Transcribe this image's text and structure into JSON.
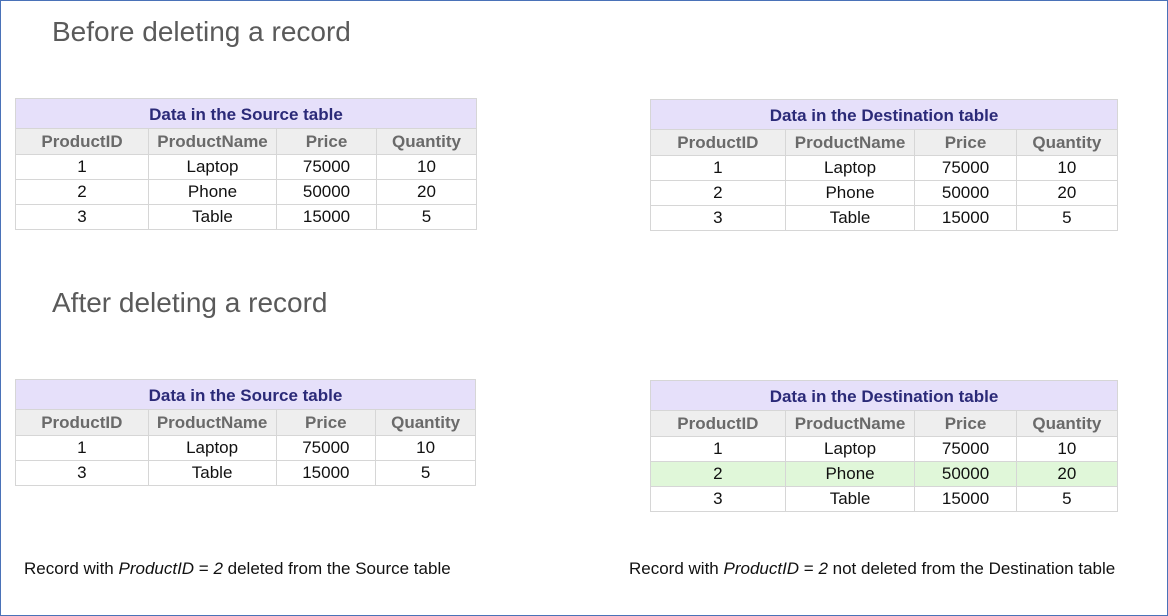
{
  "headings": {
    "before": "Before deleting a record",
    "after": "After deleting a record"
  },
  "columns": [
    "ProductID",
    "ProductName",
    "Price",
    "Quantity"
  ],
  "tables": {
    "source_before": {
      "title": "Data in the Source table",
      "rows": [
        [
          "1",
          "Laptop",
          "75000",
          "10"
        ],
        [
          "2",
          "Phone",
          "50000",
          "20"
        ],
        [
          "3",
          "Table",
          "15000",
          "5"
        ]
      ]
    },
    "destination_before": {
      "title": "Data in the Destination table",
      "rows": [
        [
          "1",
          "Laptop",
          "75000",
          "10"
        ],
        [
          "2",
          "Phone",
          "50000",
          "20"
        ],
        [
          "3",
          "Table",
          "15000",
          "5"
        ]
      ]
    },
    "source_after": {
      "title": "Data in the Source table",
      "rows": [
        [
          "1",
          "Laptop",
          "75000",
          "10"
        ],
        [
          "3",
          "Table",
          "15000",
          "5"
        ]
      ]
    },
    "destination_after": {
      "title": "Data in the Destination table",
      "highlight_row_color": "#e0f7d9",
      "highlighted_row_product_id": "2",
      "rows": [
        [
          "1",
          "Laptop",
          "75000",
          "10"
        ],
        [
          "2",
          "Phone",
          "50000",
          "20"
        ],
        [
          "3",
          "Table",
          "15000",
          "5"
        ]
      ]
    }
  },
  "captions": {
    "left": {
      "prefix": "Record with ",
      "field": "ProductID",
      "middle": " = ",
      "value": "2",
      "suffix": " deleted from the Source table"
    },
    "right": {
      "prefix": "Record with ",
      "field": "ProductID",
      "middle": " = ",
      "value": "2",
      "suffix": " not deleted from the Destination table"
    }
  },
  "colors": {
    "title_bg": "#e6e0fa",
    "title_text": "#2b2a78",
    "header_bg": "#eeeeee",
    "header_text": "#6a6a6a",
    "heading_text": "#5a5a5a",
    "frame_border": "#4a72b8"
  }
}
